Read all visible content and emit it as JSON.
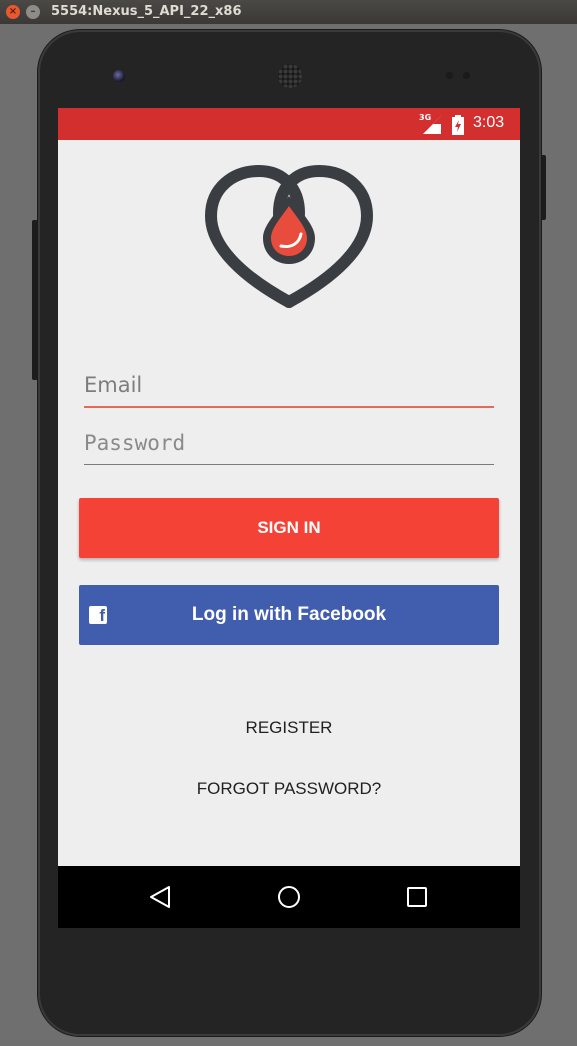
{
  "window": {
    "title": "5554:Nexus_5_API_22_x86",
    "close_glyph": "×",
    "minimize_glyph": "–"
  },
  "status_bar": {
    "network": "3G",
    "time": "3:03"
  },
  "login": {
    "email_placeholder": "Email",
    "password_placeholder": "Password",
    "sign_in_label": "SIGN IN",
    "facebook_label": "Log in with Facebook",
    "facebook_icon_glyph": "f",
    "register_label": "REGISTER",
    "forgot_password_label": "FORGOT PASSWORD?"
  },
  "icons": {
    "logo": "heart-blood-drop-icon",
    "facebook": "facebook-icon",
    "nav_back": "back-icon",
    "nav_home": "home-icon",
    "nav_recent": "recent-apps-icon"
  },
  "colors": {
    "status_bar": "#d32f2f",
    "sign_in_button": "#f44336",
    "facebook_button": "#415dae",
    "logo_dark": "#3a3d42",
    "logo_drop": "#e74c3c"
  }
}
